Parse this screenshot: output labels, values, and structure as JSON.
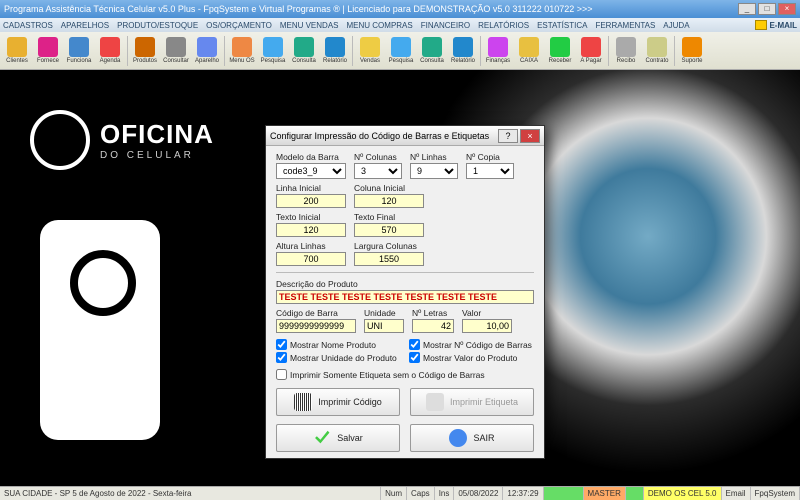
{
  "window": {
    "title": "Programa Assistência Técnica Celular v5.0 Plus - FpqSystem e Virtual Programas ® | Licenciado para  DEMONSTRAÇÃO v5.0 311222 010722 >>>"
  },
  "menu": {
    "items": [
      "CADASTROS",
      "APARELHOS",
      "PRODUTO/ESTOQUE",
      "OS/ORÇAMENTO",
      "MENU VENDAS",
      "MENU COMPRAS",
      "FINANCEIRO",
      "RELATÓRIOS",
      "ESTATÍSTICA",
      "FERRAMENTAS",
      "AJUDA"
    ],
    "email": "E-MAIL"
  },
  "toolbar": {
    "items": [
      {
        "label": "Clientes",
        "color": "#e8b030"
      },
      {
        "label": "Fornece",
        "color": "#d28"
      },
      {
        "label": "Funciona",
        "color": "#48c"
      },
      {
        "label": "Agenda",
        "color": "#e44"
      },
      {
        "label": "Produtos",
        "color": "#c60"
      },
      {
        "label": "Consultar",
        "color": "#888"
      },
      {
        "label": "Aparelho",
        "color": "#68e"
      },
      {
        "label": "Menu OS",
        "color": "#e84"
      },
      {
        "label": "Pesquisa",
        "color": "#4ae"
      },
      {
        "label": "Consulta",
        "color": "#2a8"
      },
      {
        "label": "Relatório",
        "color": "#28c"
      },
      {
        "label": "Vendas",
        "color": "#ec4"
      },
      {
        "label": "Pesquisa",
        "color": "#4ae"
      },
      {
        "label": "Consulta",
        "color": "#2a8"
      },
      {
        "label": "Relatório",
        "color": "#28c"
      },
      {
        "label": "Finanças",
        "color": "#c4e"
      },
      {
        "label": "CAIXA",
        "color": "#e8c040"
      },
      {
        "label": "Receber",
        "color": "#2c4"
      },
      {
        "label": "A Pagar",
        "color": "#e44"
      },
      {
        "label": "Recibo",
        "color": "#aaa"
      },
      {
        "label": "Contrato",
        "color": "#cc8"
      },
      {
        "label": "Suporte",
        "color": "#e80"
      }
    ]
  },
  "brand": {
    "line1": "OFICINA",
    "line2": "DO CELULAR"
  },
  "dialog": {
    "title": "Configurar Impressão do Código de Barras e Etiquetas",
    "modelo_label": "Modelo da Barra",
    "modelo_value": "code3_9",
    "ncol_label": "Nº Colunas",
    "ncol_value": "3",
    "nlin_label": "Nº Linhas",
    "nlin_value": "9",
    "ncop_label": "Nº Copia",
    "ncop_value": "1",
    "linha_ini_label": "Linha Inicial",
    "linha_ini": "200",
    "col_ini_label": "Coluna Inicial",
    "col_ini": "120",
    "texto_ini_label": "Texto Inicial",
    "texto_ini": "120",
    "texto_fin_label": "Texto Final",
    "texto_fin": "570",
    "alt_lin_label": "Altura Linhas",
    "alt_lin": "700",
    "larg_col_label": "Largura Colunas",
    "larg_col": "1550",
    "desc_label": "Descrição do Produto",
    "desc_value": "TESTE TESTE TESTE TESTE TESTE TESTE TESTE",
    "codbar_label": "Código de Barra",
    "codbar_value": "9999999999999",
    "unid_label": "Unidade",
    "unid_value": "UNI",
    "nlet_label": "Nº Letras",
    "nlet_value": "42",
    "valor_label": "Valor",
    "valor_value": "10,00",
    "chk1": "Mostrar Nome Produto",
    "chk2": "Mostrar Nº Código de Barras",
    "chk3": "Mostrar Unidade do Produto",
    "chk4": "Mostrar Valor do Produto",
    "chk5": "Imprimir Somente Etiqueta sem o Código de Barras",
    "btn_imprimir_cod": "Imprimir Código",
    "btn_imprimir_etq": "Imprimir Etiqueta",
    "btn_salvar": "Salvar",
    "btn_sair": "SAIR"
  },
  "status": {
    "left": "SUA CIDADE - SP  5 de Agosto de 2022 - Sexta-feira",
    "num": "Num",
    "caps": "Caps",
    "ins": "Ins",
    "date": "05/08/2022",
    "time": "12:37:29",
    "master": "MASTER",
    "demo": "DEMO OS CEL 5.0",
    "email": "Email",
    "fpq": "FpqSystem"
  }
}
